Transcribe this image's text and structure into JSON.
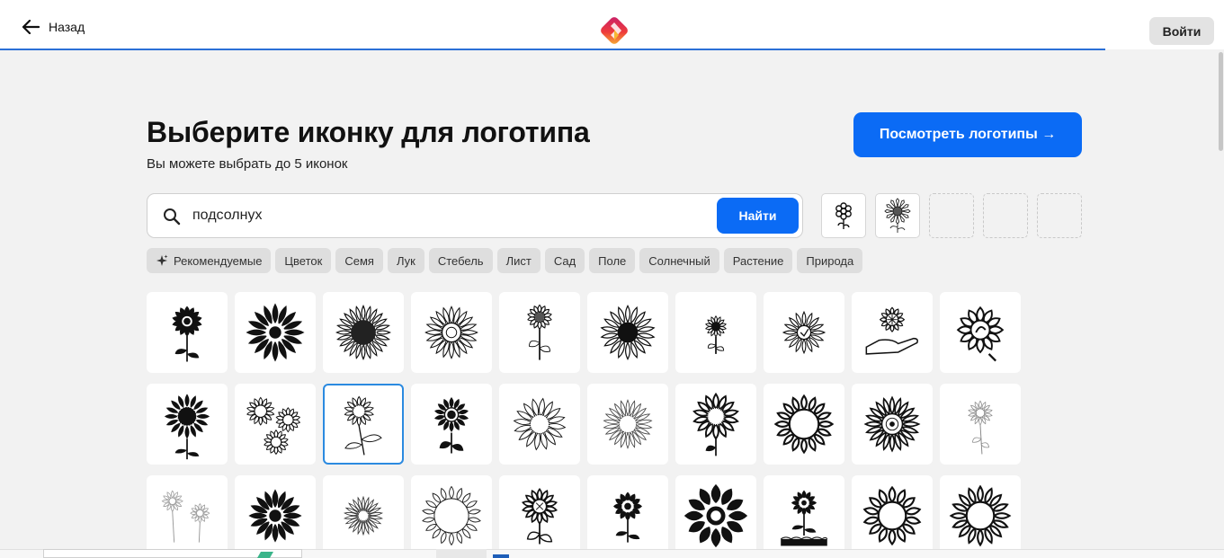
{
  "header": {
    "back_label": "Назад",
    "login_label": "Войти",
    "logo_colors": [
      "#f7b733",
      "#ee3b3b",
      "#c71f6d"
    ]
  },
  "main": {
    "title": "Выберите иконку для логотипа",
    "subtitle": "Вы можете выбрать до 5 иконок",
    "view_button_label": "Посмотреть логотипы →"
  },
  "search": {
    "value": "подсолнух",
    "placeholder": "",
    "button_label": "Найти"
  },
  "selected_slots": {
    "max": 5,
    "filled": 2
  },
  "chips": [
    {
      "label": "Рекомендуемые",
      "icon": "sparkle-icon"
    },
    {
      "label": "Цветок"
    },
    {
      "label": "Семя"
    },
    {
      "label": "Лук"
    },
    {
      "label": "Стебель"
    },
    {
      "label": "Лист"
    },
    {
      "label": "Сад"
    },
    {
      "label": "Поле"
    },
    {
      "label": "Солнечный"
    },
    {
      "label": "Растение"
    },
    {
      "label": "Природа"
    }
  ],
  "icon_grid": {
    "rows": 3,
    "columns": 10,
    "selected_index": 12
  },
  "colors": {
    "accent": "#0b6bf5",
    "selected_border": "#2b8ae0",
    "header_rule": "#2b6fd6",
    "background": "#f2f2f2"
  }
}
